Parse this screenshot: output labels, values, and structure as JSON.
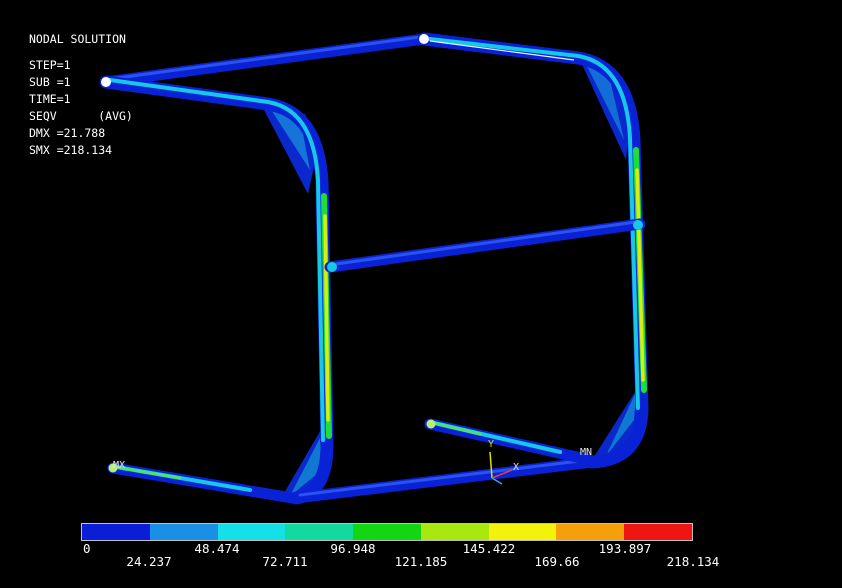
{
  "header": {
    "title": "NODAL SOLUTION",
    "step": "STEP=1",
    "sub": "SUB =1",
    "time": "TIME=1",
    "seqv": "SEQV      (AVG)",
    "dmx": "DMX =21.788",
    "smx": "SMX =218.134"
  },
  "markers": {
    "mx": "MX",
    "mn": "MN",
    "axis_y": "Y",
    "axis_x": "X"
  },
  "legend": {
    "colors": [
      "#0a1ed8",
      "#1a8fe6",
      "#14e0e8",
      "#12d9a0",
      "#13d613",
      "#a8e80e",
      "#f2f20a",
      "#f5a00a",
      "#f01414"
    ],
    "top_labels": [
      "0",
      "48.474",
      "96.948",
      "145.422",
      "193.897"
    ],
    "bottom_labels": [
      "24.237",
      "72.711",
      "121.185",
      "169.66",
      "218.134"
    ]
  }
}
